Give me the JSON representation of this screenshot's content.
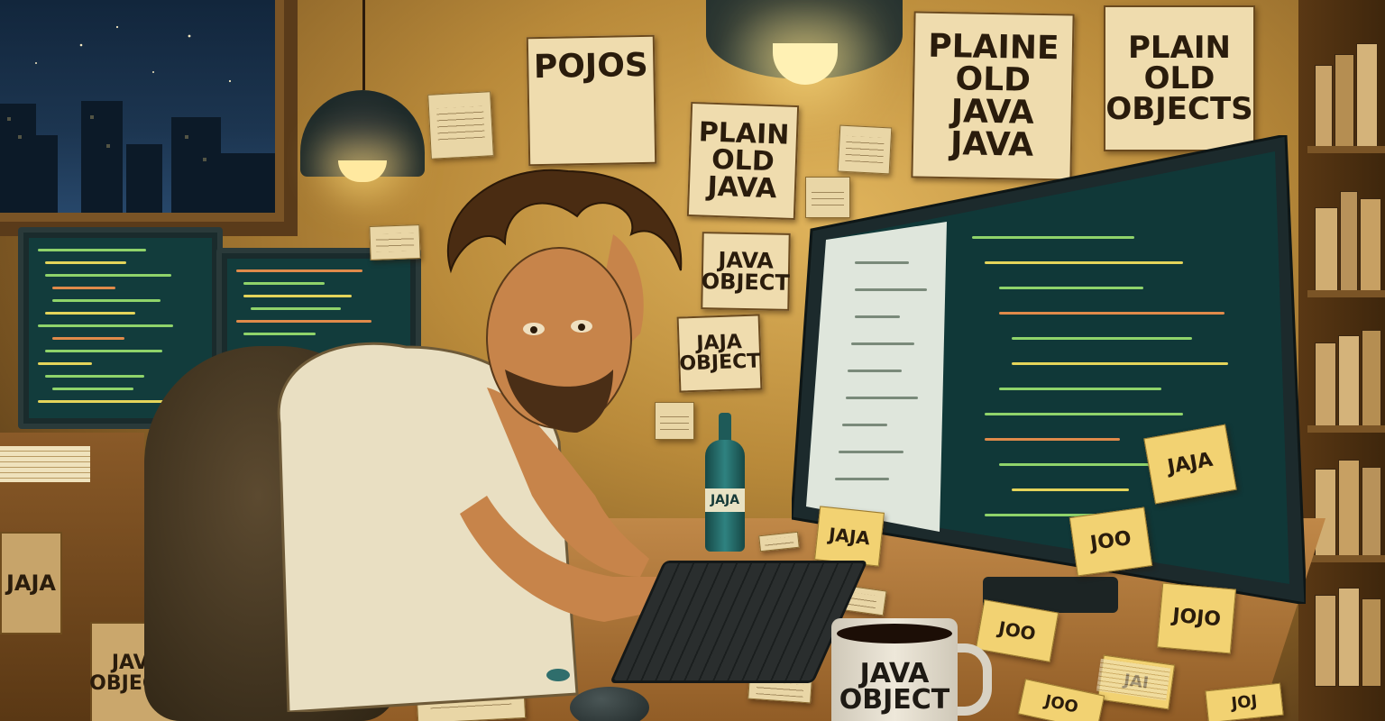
{
  "scene": {
    "wall_notes": {
      "pojos": "POJOS",
      "plaine_old_java_java": "PLAINE\nOLD\nJAVA\nJAVA",
      "plain_old_objects": "PLAIN\nOLD\nOBJECTS",
      "plain_old_java": "PLAIN\nOLD\nJAVA",
      "java_object": "JAVA\nOBJECT",
      "jaja_object": "JAJA\nOBJECT"
    },
    "sticky_notes": {
      "monitor_jaja": "JAJA",
      "monitor_joo": "JOO",
      "desk_jaja": "JAJA",
      "right_jojo": "JOJO",
      "desk_joo": "JOO",
      "desk_jai": "JAI",
      "desk_joo_bottom": "JOO",
      "desk_joj_bottom": "JOJ"
    },
    "bottle_label": "JAJA",
    "mug_text": "JAVA\nOBJECT",
    "box_labels": {
      "box_top": "JAJA",
      "box_bottom": "JAVA\nOBJECTS"
    },
    "colors": {
      "wall_glow": "#e0b45c",
      "night_sky": "#1c3550",
      "screen_bg": "#103838",
      "code_green": "#8fd36a",
      "code_yellow": "#e4d45a",
      "code_orange": "#e08a4a",
      "sticky_yellow": "#f2d272",
      "poster_paper": "#efdcae"
    }
  }
}
